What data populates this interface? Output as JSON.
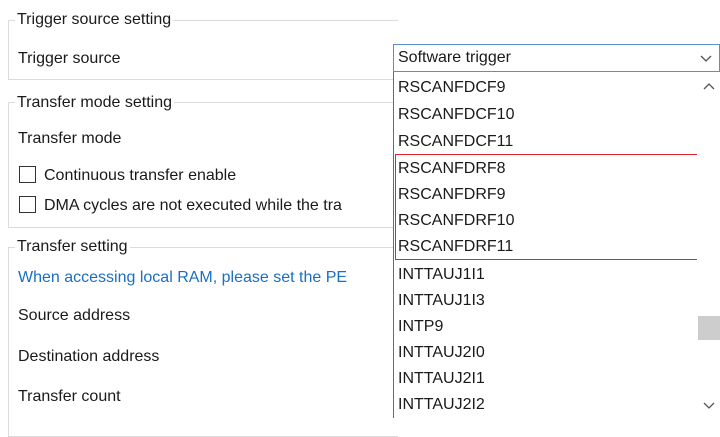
{
  "trigger_group": {
    "title": "Trigger source setting",
    "trigger_source_label": "Trigger source",
    "selected_value": "Software trigger"
  },
  "transfer_mode_group": {
    "title": "Transfer mode setting",
    "transfer_mode_label": "Transfer mode",
    "continuous_label": "Continuous transfer enable",
    "dma_cycles_label": "DMA cycles are not executed while the tra"
  },
  "transfer_group": {
    "title": "Transfer setting",
    "local_ram_note": "When accessing local RAM, please set the PE",
    "source_address_label": "Source address",
    "destination_address_label": "Destination address",
    "transfer_count_label": "Transfer count"
  },
  "dropdown": {
    "items": [
      "RSCANFDCF9",
      "RSCANFDCF10",
      "RSCANFDCF11",
      "RSCANFDRF8",
      "RSCANFDRF9",
      "RSCANFDRF10",
      "RSCANFDRF11",
      "INTTAUJ1I1",
      "INTTAUJ1I3",
      "INTP9",
      "INTTAUJ2I0",
      "INTTAUJ2I1",
      "INTTAUJ2I2"
    ],
    "highlight_color": "#e0232e"
  }
}
